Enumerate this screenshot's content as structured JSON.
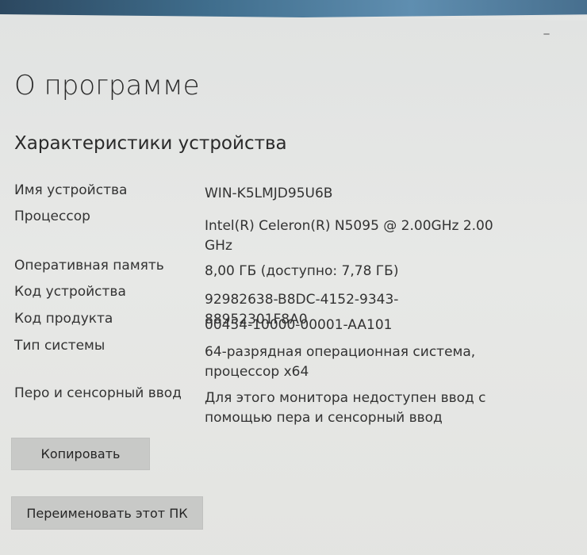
{
  "window": {
    "minimize_glyph": "_"
  },
  "page": {
    "title": "О программе",
    "section_title": "Характеристики устройства"
  },
  "specs": [
    {
      "label": "Имя устройства",
      "value": "WIN-K5LMJD95U6B"
    },
    {
      "label": "Процессор",
      "value": "Intel(R) Celeron(R) N5095 @ 2.00GHz   2.00 GHz"
    },
    {
      "label": "Оперативная память",
      "value": "8,00 ГБ (доступно: 7,78 ГБ)"
    },
    {
      "label": "Код устройства",
      "value": "92982638-B8DC-4152-9343-88952301F8A0"
    },
    {
      "label": "Код продукта",
      "value": "00454-10000-00001-AA101"
    },
    {
      "label": "Тип системы",
      "value": "64-разрядная операционная система, процессор x64"
    },
    {
      "label": "Перо и сенсорный ввод",
      "value": "Для этого монитора недоступен ввод с помощью пера и сенсорный ввод"
    }
  ],
  "buttons": {
    "copy": "Копировать",
    "rename": "Переименовать этот ПК"
  }
}
